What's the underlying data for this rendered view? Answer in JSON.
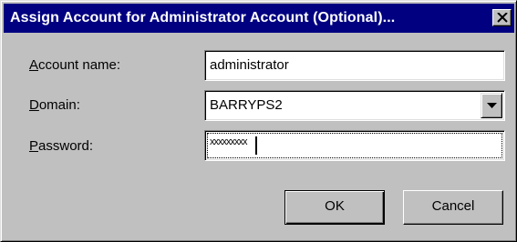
{
  "dialog": {
    "title": "Assign Account for Administrator Account (Optional)...",
    "close_glyph": "✕"
  },
  "fields": {
    "account_name": {
      "label_mnemonic": "A",
      "label_rest": "ccount name:",
      "value": "administrator"
    },
    "domain": {
      "label_mnemonic": "D",
      "label_rest": "omain:",
      "value": "BARRYPS2"
    },
    "password": {
      "label_mnemonic": "P",
      "label_rest": "assword:",
      "value": "xxxxxxxxx"
    }
  },
  "buttons": {
    "ok_label": "OK",
    "cancel_label": "Cancel"
  },
  "colors": {
    "title_bar": "#000080",
    "face": "#c0c0c0",
    "field_bg": "#ffffff"
  },
  "icons": {
    "close": "close-icon",
    "dropdown": "chevron-down-icon"
  }
}
